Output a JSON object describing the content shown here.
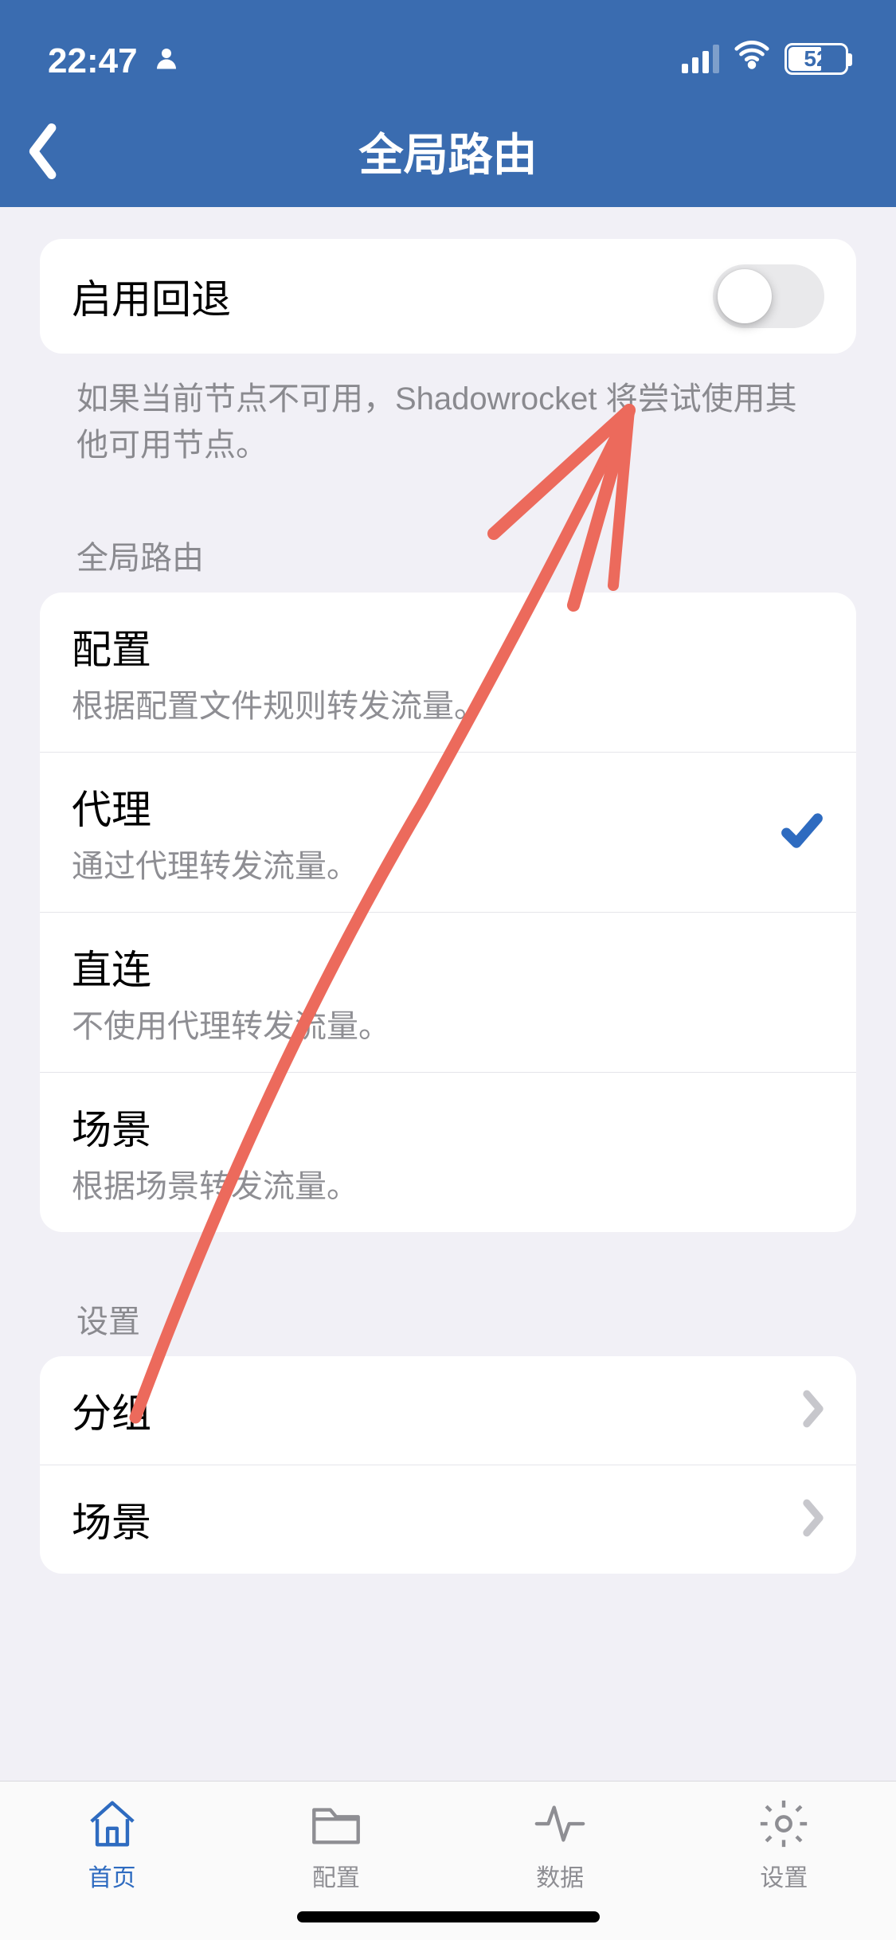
{
  "status": {
    "time": "22:47",
    "battery_pct": "52"
  },
  "nav": {
    "title": "全局路由"
  },
  "fallback": {
    "title": "启用回退",
    "note": "如果当前节点不可用，Shadowrocket 将尝试使用其他可用节点。"
  },
  "routing": {
    "header": "全局路由",
    "items": [
      {
        "title": "配置",
        "sub": "根据配置文件规则转发流量。",
        "selected": false
      },
      {
        "title": "代理",
        "sub": "通过代理转发流量。",
        "selected": true
      },
      {
        "title": "直连",
        "sub": "不使用代理转发流量。",
        "selected": false
      },
      {
        "title": "场景",
        "sub": "根据场景转发流量。",
        "selected": false
      }
    ]
  },
  "settings": {
    "header": "设置",
    "items": [
      {
        "title": "分组"
      },
      {
        "title": "场景"
      }
    ]
  },
  "tabs": [
    {
      "label": "首页",
      "active": true
    },
    {
      "label": "配置",
      "active": false
    },
    {
      "label": "数据",
      "active": false
    },
    {
      "label": "设置",
      "active": false
    }
  ]
}
